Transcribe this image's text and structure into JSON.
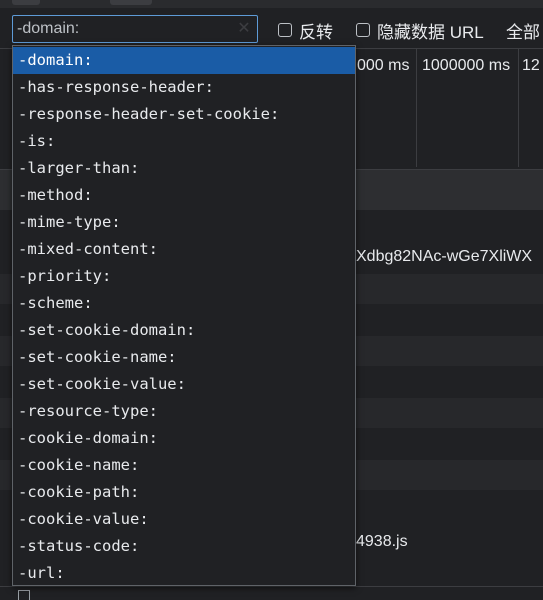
{
  "filter": {
    "value": "-domain:",
    "clear_icon": "close-icon"
  },
  "checkboxes": [
    {
      "label": "反转",
      "checked": false
    },
    {
      "label": "隐藏数据 URL",
      "checked": false
    },
    {
      "label": "全部",
      "checked": false
    }
  ],
  "timeline": {
    "labels": [
      "000 ms",
      "1000000 ms",
      "12"
    ]
  },
  "rows": {
    "cell_1": "Xdbg82NAc-wGe7XliWX",
    "cell_2": "4938.js"
  },
  "autocomplete": {
    "selected_index": 0,
    "items": [
      "-domain:",
      "-has-response-header:",
      "-response-header-set-cookie:",
      "-is:",
      "-larger-than:",
      "-method:",
      "-mime-type:",
      "-mixed-content:",
      "-priority:",
      "-scheme:",
      "-set-cookie-domain:",
      "-set-cookie-name:",
      "-set-cookie-value:",
      "-resource-type:",
      "-cookie-domain:",
      "-cookie-name:",
      "-cookie-path:",
      "-cookie-value:",
      "-status-code:",
      "-url:"
    ]
  },
  "colors": {
    "background": "#202124",
    "selection": "#1a5ca6",
    "focus_border": "#5e9bd7"
  }
}
